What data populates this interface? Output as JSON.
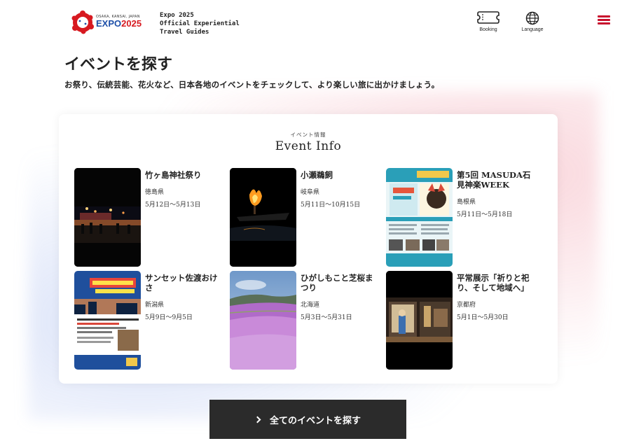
{
  "header": {
    "logo_small": "OSAKA, KANSAI, JAPAN",
    "logo_main_a": "EXPO",
    "logo_main_b": "2025",
    "tagline": [
      "Expo 2025",
      "Official Experiential",
      "Travel Guides"
    ],
    "booking_label": "Booking",
    "language_label": "Language",
    "icons": {
      "booking": "ticket-icon",
      "language": "globe-icon",
      "menu": "hamburger-menu-icon"
    },
    "accent": "#c8102e"
  },
  "page": {
    "title": "イベントを探す",
    "description": "お祭り、伝統芸能、花火など、日本各地のイベントをチェックして、より楽しい旅に出かけましょう。"
  },
  "event_section": {
    "subtitle": "イベント情報",
    "title": "Event Info",
    "events": [
      {
        "name": "竹ヶ島神社祭り",
        "prefecture": "徳島県",
        "date": "5月12日〜5月13日"
      },
      {
        "name": "小瀬鵜飼",
        "prefecture": "岐阜県",
        "date": "5月11日〜10月15日"
      },
      {
        "name": "第5回 MASUDA石見神楽WEEK",
        "prefecture": "島根県",
        "date": "5月11日〜5月18日"
      },
      {
        "name": "サンセット佐渡おけさ",
        "prefecture": "新潟県",
        "date": "5月9日〜9月5日"
      },
      {
        "name": "ひがしもこと芝桜まつり",
        "prefecture": "北海道",
        "date": "5月3日〜5月31日"
      },
      {
        "name": "平常展示「祈りと祀り、そして地域へ」",
        "prefecture": "京都府",
        "date": "5月1日〜5月30日"
      }
    ]
  },
  "cta": {
    "label": "全てのイベントを探す",
    "icon": "chevron-right-icon"
  }
}
